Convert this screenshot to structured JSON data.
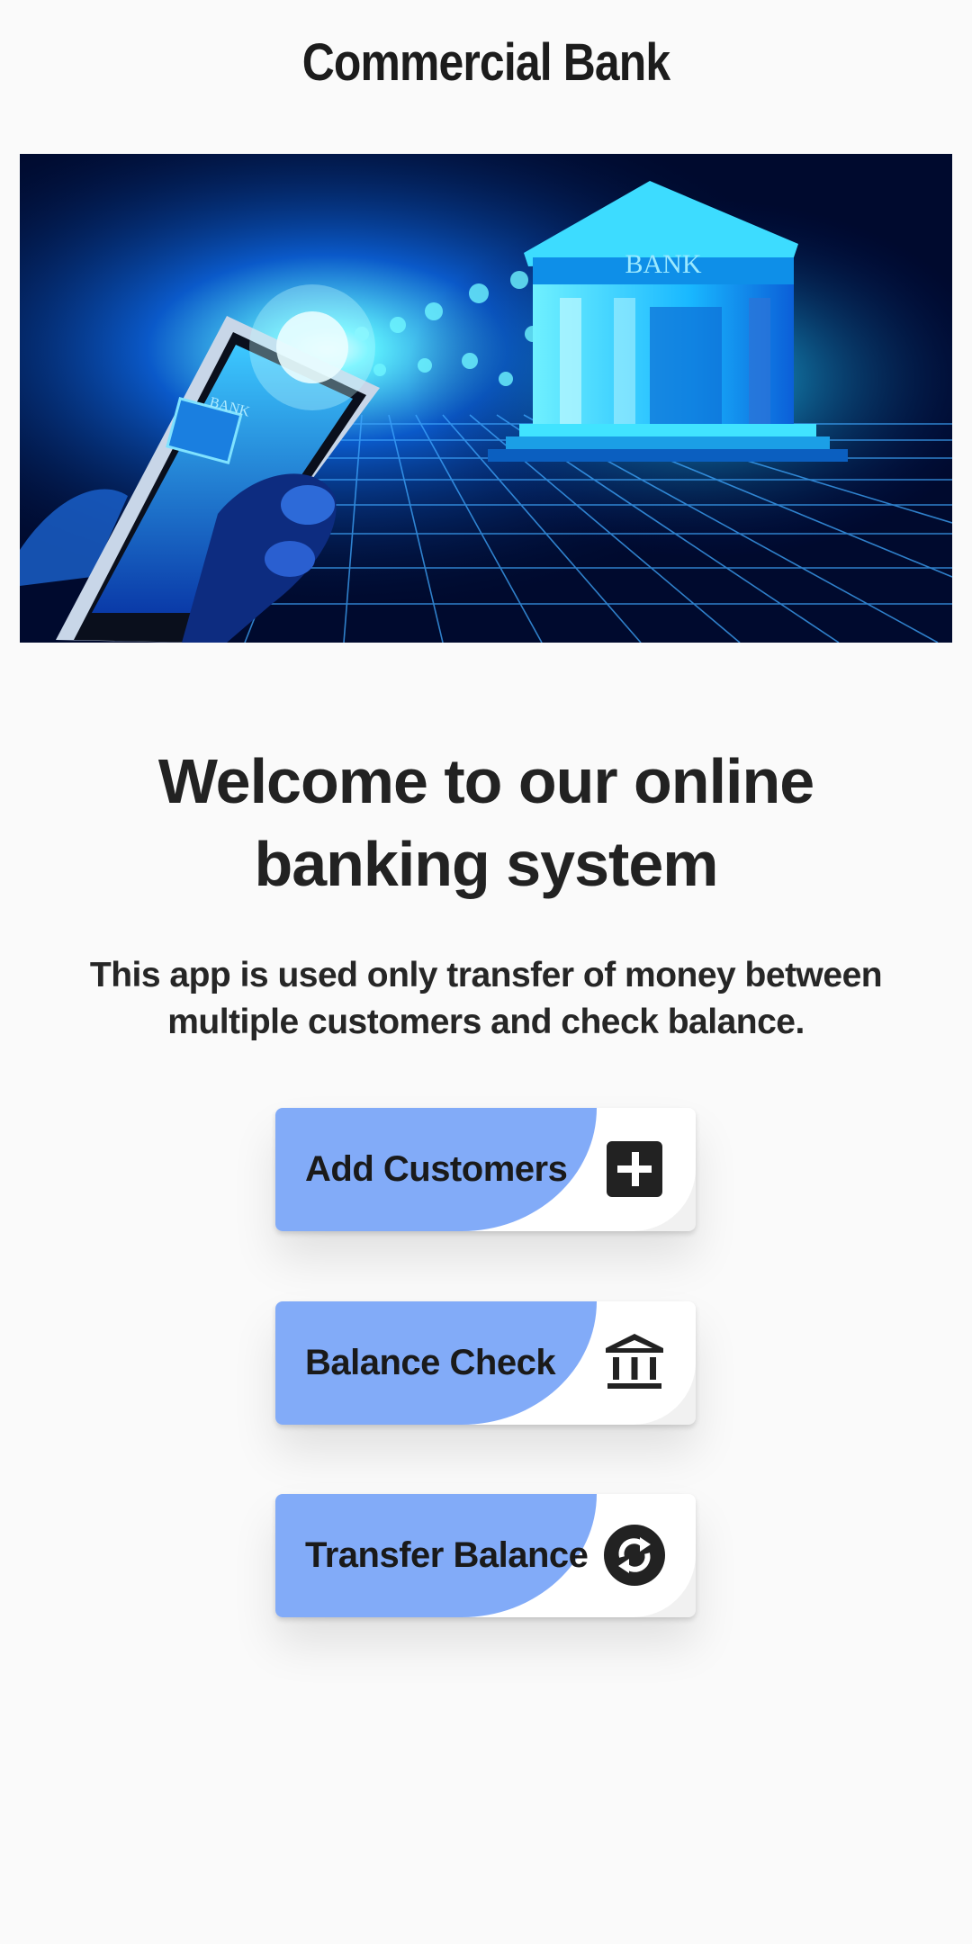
{
  "header": {
    "title": "Commercial Bank"
  },
  "hero": {
    "sign_text": "BANK",
    "phone_sign_text": "BANK"
  },
  "main": {
    "welcome": "Welcome to our online banking system",
    "description": "This app is used only transfer of money between multiple customers and check balance."
  },
  "actions": [
    {
      "label": "Add Customers",
      "icon": "plus-square-icon"
    },
    {
      "label": "Balance Check",
      "icon": "bank-icon"
    },
    {
      "label": "Transfer Balance",
      "icon": "sync-icon"
    }
  ],
  "colors": {
    "button_accent": "#82abf8",
    "icon_color": "#222222",
    "background": "#fafafa"
  }
}
